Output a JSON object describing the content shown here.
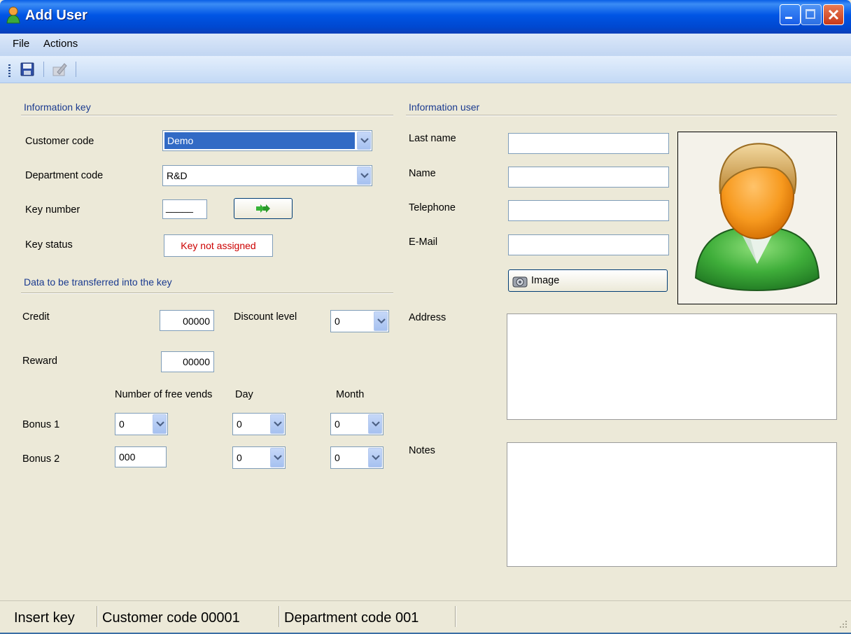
{
  "window": {
    "title": "Add User"
  },
  "menu": {
    "items": [
      "File",
      "Actions"
    ]
  },
  "toolbar": {
    "icons": [
      "save-icon",
      "edit-icon"
    ]
  },
  "info_key": {
    "section_title": "Information key",
    "customer_code": {
      "label": "Customer code",
      "value": "Demo"
    },
    "department_code": {
      "label": "Department code",
      "value": "R&D"
    },
    "key_number": {
      "label": "Key number",
      "value": "_____"
    },
    "key_status": {
      "label": "Key status",
      "value": "Key not assigned"
    }
  },
  "transfer": {
    "section_title": "Data to be transferred into the key",
    "credit": {
      "label": "Credit",
      "value": "00000"
    },
    "discount_level": {
      "label": "Discount level",
      "value": "0"
    },
    "reward": {
      "label": "Reward",
      "value": "00000"
    },
    "columns": {
      "free_vends": "Number of free vends",
      "day": "Day",
      "month": "Month"
    },
    "bonus1": {
      "label": "Bonus 1",
      "free_vends": "0",
      "day": "0",
      "month": "0"
    },
    "bonus2": {
      "label": "Bonus 2",
      "free_vends": "000",
      "day": "0",
      "month": "0"
    }
  },
  "info_user": {
    "section_title": "Information user",
    "last_name": {
      "label": "Last name",
      "value": ""
    },
    "name": {
      "label": "Name",
      "value": ""
    },
    "telephone": {
      "label": "Telephone",
      "value": ""
    },
    "email": {
      "label": "E-Mail",
      "value": ""
    },
    "image_button": "Image",
    "address_label": "Address",
    "notes_label": "Notes"
  },
  "status": {
    "insert_key": "Insert key",
    "customer_code": "Customer code  00001",
    "department_code": "Department code  001"
  },
  "colors": {
    "status_red": "#cc0000",
    "section_blue": "#1a3a8f",
    "selection": "#316ac5"
  }
}
